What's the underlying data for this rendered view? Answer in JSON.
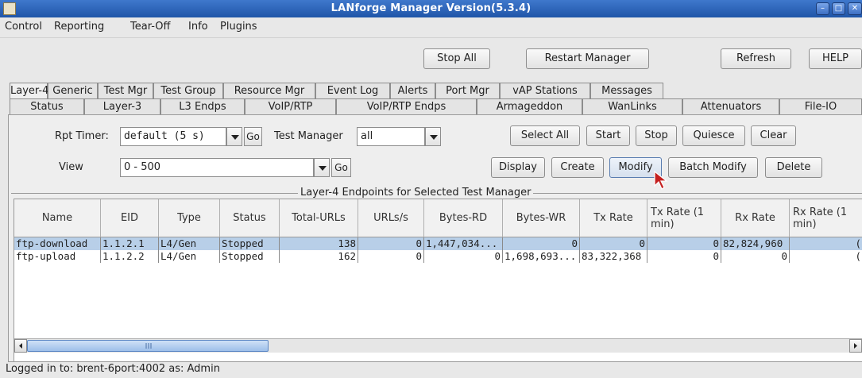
{
  "window": {
    "title": "LANforge Manager   Version(5.3.4)"
  },
  "menu": [
    "Control",
    "Reporting",
    "Tear-Off",
    "Info",
    "Plugins"
  ],
  "toolbar": {
    "stop_all": "Stop All",
    "restart": "Restart Manager",
    "refresh": "Refresh",
    "help": "HELP"
  },
  "tabs_row1": [
    "Layer-4",
    "Generic",
    "Test Mgr",
    "Test Group",
    "Resource Mgr",
    "Event Log",
    "Alerts",
    "Port Mgr",
    "vAP Stations",
    "Messages"
  ],
  "tabs_row2": [
    "Status",
    "Layer-3",
    "L3 Endps",
    "VoIP/RTP",
    "VoIP/RTP Endps",
    "Armageddon",
    "WanLinks",
    "Attenuators",
    "File-IO"
  ],
  "controls": {
    "rpt_timer_label": "Rpt Timer:",
    "rpt_timer_value": "default (5 s)",
    "go": "Go",
    "test_manager_label": "Test Manager",
    "test_manager_value": "all",
    "view_label": "View",
    "view_value": "0 - 500",
    "select_all": "Select All",
    "start": "Start",
    "stop": "Stop",
    "quiesce": "Quiesce",
    "clear": "Clear",
    "display": "Display",
    "create": "Create",
    "modify": "Modify",
    "batch_modify": "Batch Modify",
    "delete": "Delete"
  },
  "table": {
    "title": "Layer-4 Endpoints for Selected Test Manager",
    "headers": [
      "Name",
      "EID",
      "Type",
      "Status",
      "Total-URLs",
      "URLs/s",
      "Bytes-RD",
      "Bytes-WR",
      "Tx Rate",
      "Tx Rate (1 min)",
      "Rx Rate",
      "Rx Rate (1 min)"
    ],
    "rows": [
      [
        "ftp-download",
        "1.1.2.1",
        "L4/Gen",
        "Stopped",
        "138",
        "0",
        "1,447,034...",
        "0",
        "0",
        "0",
        "82,824,960",
        "("
      ],
      [
        "ftp-upload",
        "1.1.2.2",
        "L4/Gen",
        "Stopped",
        "162",
        "0",
        "0",
        "1,698,693...",
        "83,322,368",
        "0",
        "0",
        "("
      ]
    ]
  },
  "status_bar": "Logged in to:  brent-6port:4002  as:  Admin"
}
